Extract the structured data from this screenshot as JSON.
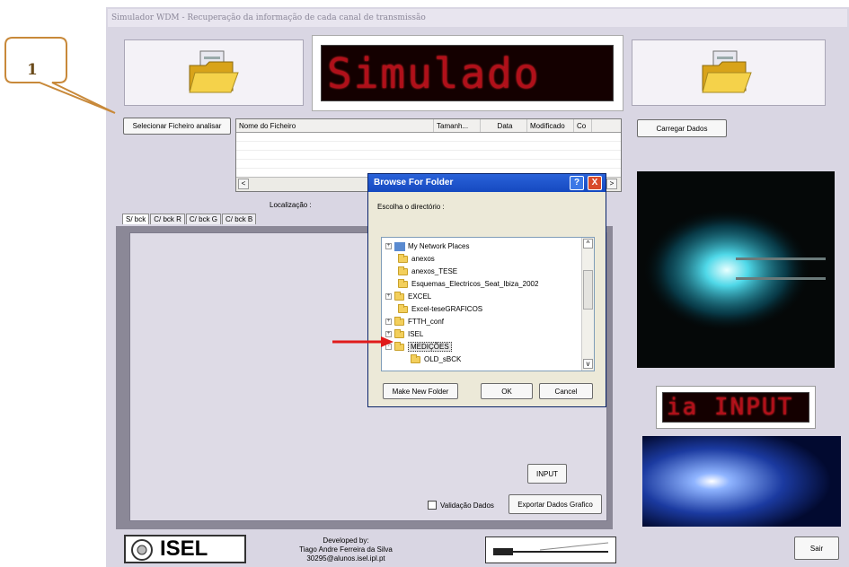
{
  "window": {
    "title": "Simulador WDM - Recuperação da informação de cada canal de transmissão"
  },
  "callout": {
    "number": "1"
  },
  "buttons": {
    "select_file": "Selecionar Ficheiro analisar",
    "load_data": "Carregar Dados",
    "input": "INPUT",
    "export": "Exportar Dados Grafico",
    "exit": "Sair"
  },
  "led_top": "Simulado",
  "led_right": "ia INPUT",
  "file_table": {
    "columns": [
      "Nome do Ficheiro",
      "Tamanh...",
      "Data",
      "Modificado",
      "Co"
    ]
  },
  "location_label": "Localização :",
  "tabs": [
    "S/ bck",
    "C/ bck R",
    "C/ bck G",
    "C/ bck B"
  ],
  "validation": {
    "label": "Validação Dados",
    "checked": false
  },
  "footer": {
    "logo_text": "ISEL",
    "developed_by": "Developed by:",
    "author": "Tiago Andre Ferreira da Silva",
    "email": "30295@alunos.isel.ipl.pt"
  },
  "dialog": {
    "title": "Browse For Folder",
    "prompt": "Escolha o directório :",
    "help_label": "?",
    "close_label": "X",
    "tree": [
      {
        "label": "My Network Places",
        "expander": "+",
        "icon": "network-icon"
      },
      {
        "label": "anexos",
        "expander": "",
        "icon": "folder-icon"
      },
      {
        "label": "anexos_TESE",
        "expander": "",
        "icon": "folder-icon"
      },
      {
        "label": "Esquemas_Electricos_Seat_Ibiza_2002",
        "expander": "",
        "icon": "folder-icon"
      },
      {
        "label": "EXCEL",
        "expander": "+",
        "icon": "folder-icon"
      },
      {
        "label": "Excel-teseGRAFICOS",
        "expander": "",
        "icon": "folder-icon"
      },
      {
        "label": "FTTH_conf",
        "expander": "+",
        "icon": "folder-icon"
      },
      {
        "label": "ISEL",
        "expander": "+",
        "icon": "folder-icon"
      },
      {
        "label": "MEDIÇÕES",
        "expander": "-",
        "icon": "folder-icon",
        "selected": true
      },
      {
        "label": "OLD_sBCK",
        "expander": "",
        "icon": "folder-icon"
      }
    ],
    "make_new_folder": "Make New Folder",
    "ok": "OK",
    "cancel": "Cancel"
  },
  "colors": {
    "window_bg": "#d9d6e3",
    "callout_border": "#c8893a",
    "led_red": "#b0101a",
    "dialog_title": "#2a62d9",
    "arrow_red": "#e01b1b"
  }
}
